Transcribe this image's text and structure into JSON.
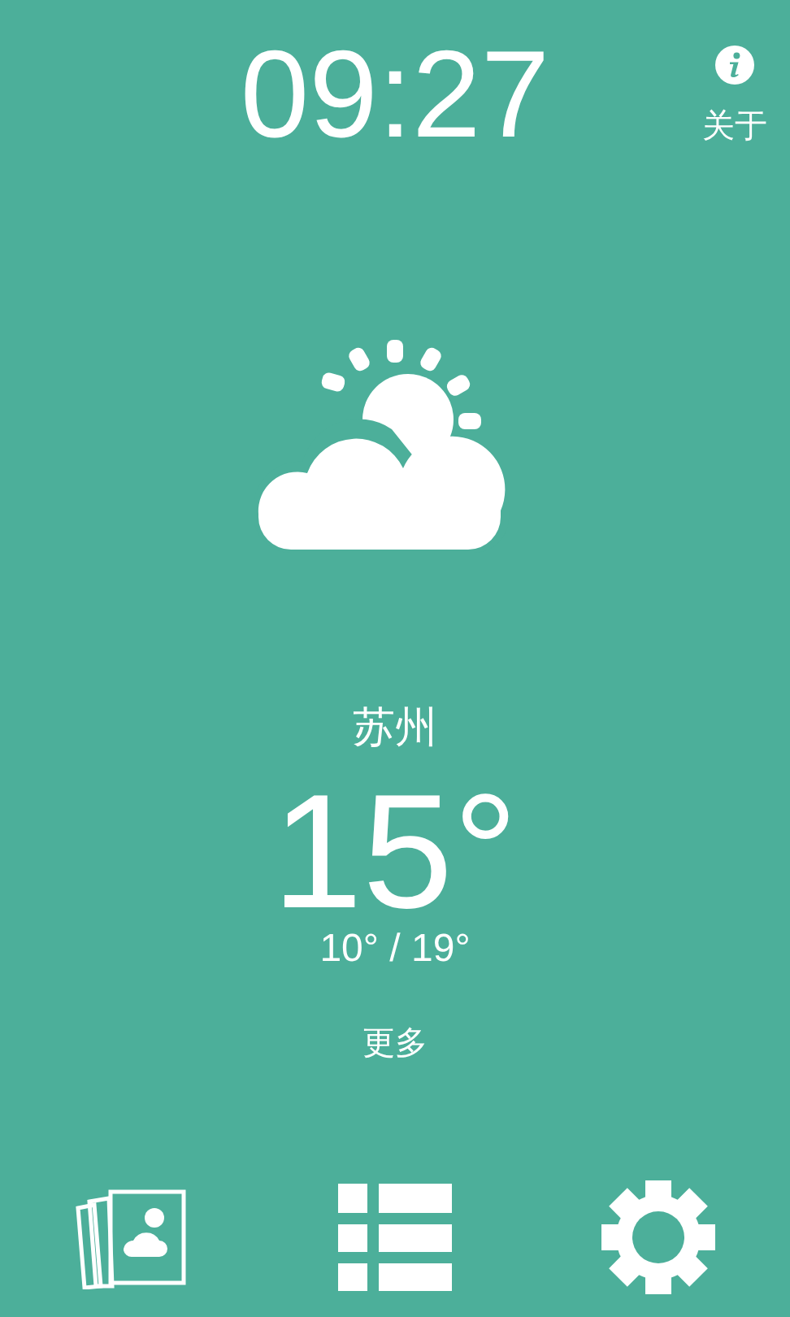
{
  "clock": "09:27",
  "about": {
    "label": "关于"
  },
  "weather": {
    "city": "苏州",
    "temperature": "15°",
    "range": "10° / 19°",
    "more": "更多"
  },
  "toolbar": [
    {
      "kind": "gallery"
    },
    {
      "kind": "list"
    },
    {
      "kind": "settings"
    }
  ]
}
